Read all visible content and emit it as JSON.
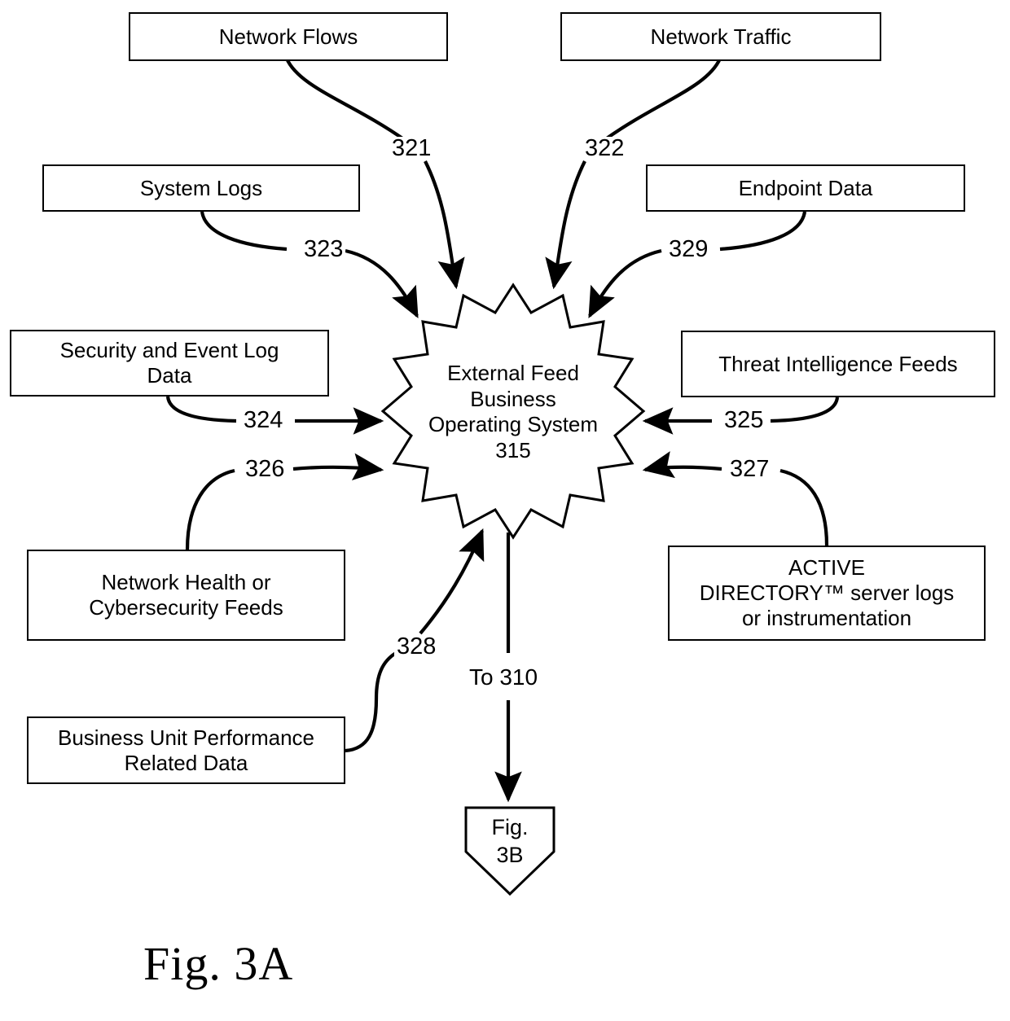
{
  "figure": {
    "caption": "Fig. 3A"
  },
  "hub": {
    "line1": "External Feed",
    "line2": "Business",
    "line3": "Operating System",
    "line4": "315"
  },
  "boxes": [
    {
      "id": "network-flows",
      "label": "Network Flows"
    },
    {
      "id": "network-traffic",
      "label": "Network Traffic"
    },
    {
      "id": "system-logs",
      "label": "System Logs"
    },
    {
      "id": "endpoint-data",
      "label": "Endpoint Data"
    },
    {
      "id": "security-event-log",
      "line1": "Security and Event Log",
      "line2": "Data"
    },
    {
      "id": "threat-intel",
      "label": "Threat Intelligence Feeds"
    },
    {
      "id": "network-health",
      "line1": "Network Health or",
      "line2": "Cybersecurity Feeds"
    },
    {
      "id": "active-directory",
      "line1": "ACTIVE",
      "line2": "DIRECTORY™ server logs",
      "line3": "or instrumentation"
    },
    {
      "id": "business-unit",
      "line1": "Business Unit Performance",
      "line2": "Related Data"
    }
  ],
  "reference_numerals": {
    "n321": "321",
    "n322": "322",
    "n323": "323",
    "n324": "324",
    "n325": "325",
    "n326": "326",
    "n327": "327",
    "n328": "328",
    "n329": "329"
  },
  "flow": {
    "to_label": "To 310",
    "connector_line1": "Fig.",
    "connector_line2": "3B"
  },
  "colors": {
    "stroke": "#000000",
    "background": "#ffffff"
  }
}
